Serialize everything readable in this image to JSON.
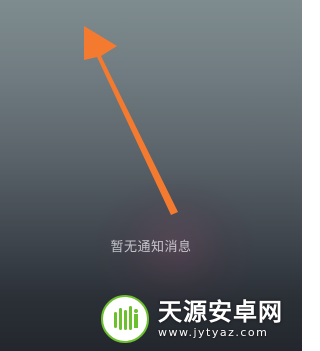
{
  "notifications": {
    "empty_message": "暂无通知消息"
  },
  "hint": {
    "icon": "orange-arrow-up-left",
    "color": "#f47a30"
  },
  "watermark": {
    "title": "天源安卓网",
    "url": "www.jytyaz.com",
    "logo_color": "#6cbf2d"
  }
}
